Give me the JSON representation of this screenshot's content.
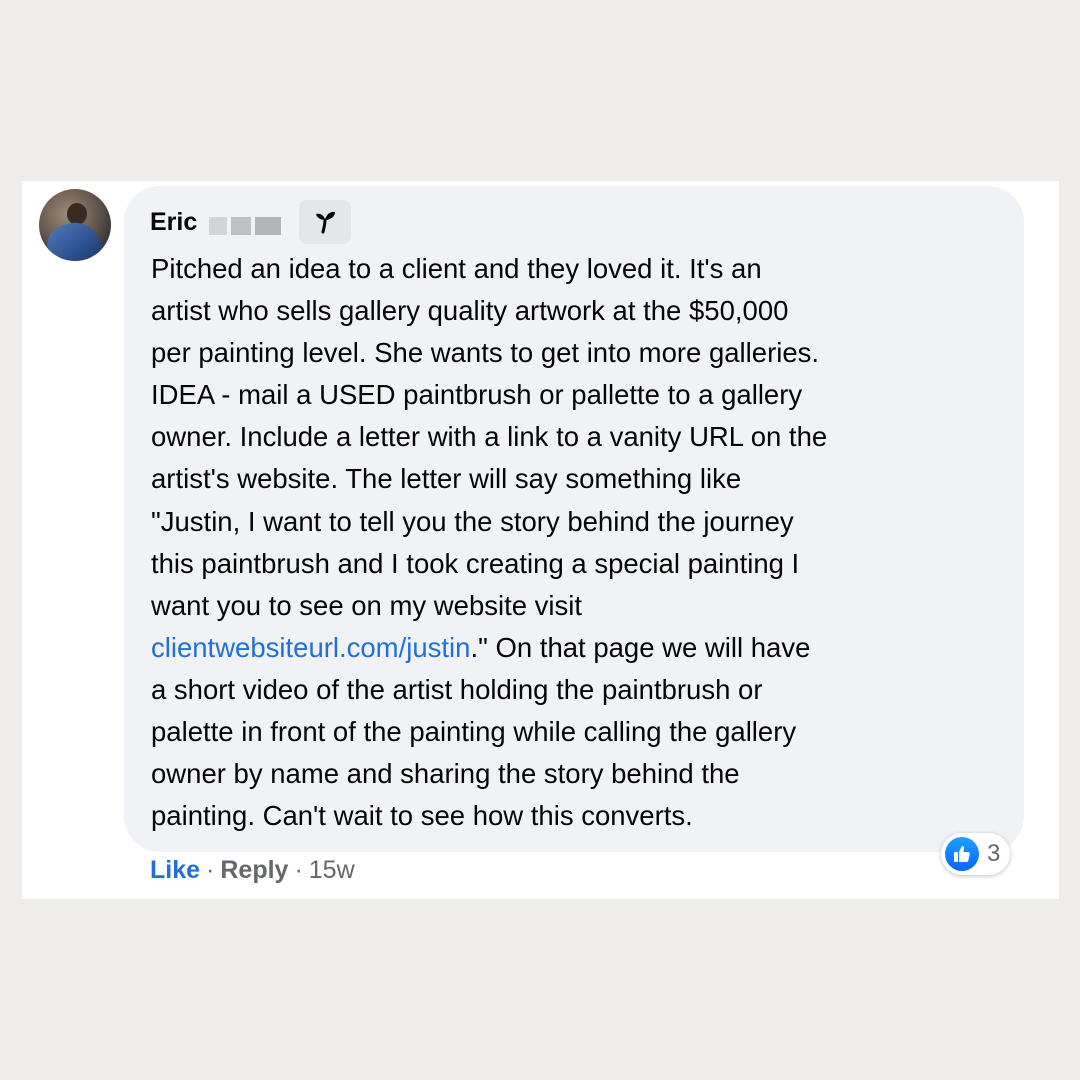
{
  "comment": {
    "author": "Eric",
    "lines": [
      "Pitched an idea to a client and they loved it. It's an",
      "artist who sells gallery quality artwork at the $50,000",
      "per painting level. She wants to get into more galleries.",
      "IDEA - mail a USED paintbrush or pallette to a gallery",
      "owner. Include a letter with a link to a vanity URL on the",
      "artist's website. The letter will say something like",
      "\"Justin, I want to tell you the story behind the journey",
      "this paintbrush and I took creating a special painting I",
      "want you to see on my website visit"
    ],
    "link_text": "clientwebsiteurl.com/justin",
    "link_suffix": ".\" On that page we will have",
    "lines_after": [
      "a short video of the artist holding the paintbrush or",
      "palette in front of the painting while calling the gallery",
      "owner by name and sharing the story behind the",
      "painting. Can't wait to see how this converts."
    ]
  },
  "actions": {
    "like_label": "Like",
    "separator": "·",
    "reply_label": "Reply",
    "timestamp": "15w"
  },
  "reactions": {
    "icon": "thumbs-up-icon",
    "count": "3"
  },
  "colors": {
    "link": "#216fdb",
    "bubble": "#f0f2f5",
    "like_blue": "#0866ff"
  }
}
